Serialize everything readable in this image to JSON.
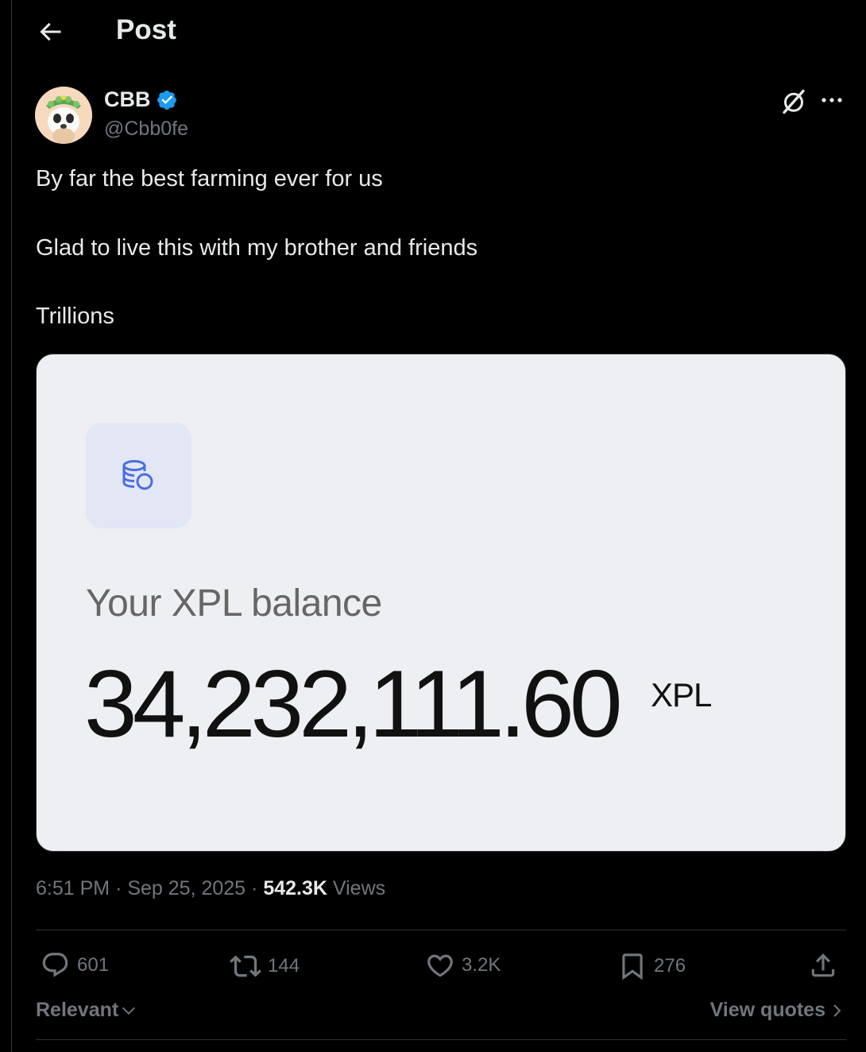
{
  "header": {
    "title": "Post"
  },
  "author": {
    "name": "CBB",
    "handle": "@Cbb0fe",
    "verified": true,
    "badge_color": "#1d9bf0"
  },
  "tweet": {
    "lines": [
      "By far the best farming ever for us",
      "Glad to live this with my brother and friends",
      "Trillions"
    ]
  },
  "media": {
    "balance_label": "Your XPL balance",
    "balance_value": "34,232,111.60",
    "balance_unit": "XPL",
    "icon": "coins-icon"
  },
  "meta": {
    "time": "6:51 PM",
    "separator": "·",
    "date": "Sep 25, 2025",
    "views_count": "542.3K",
    "views_label": "Views"
  },
  "actions": {
    "replies": "601",
    "reposts": "144",
    "likes": "3.2K",
    "bookmarks": "276"
  },
  "footer": {
    "sort_label": "Relevant",
    "quotes_label": "View quotes"
  },
  "colors": {
    "background": "#000000",
    "text": "#e7e9ea",
    "muted": "#71767b",
    "accent": "#1d9bf0"
  }
}
